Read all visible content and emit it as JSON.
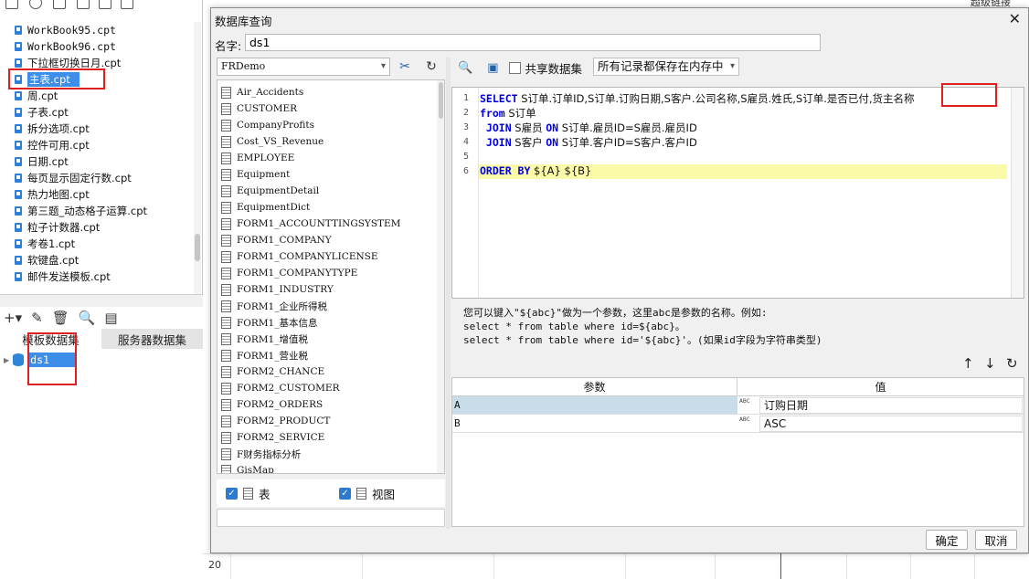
{
  "left_panel": {
    "files": [
      {
        "name": "WorkBook95.cpt",
        "mono": true
      },
      {
        "name": "WorkBook96.cpt",
        "mono": true
      },
      {
        "name": "下拉框切换日月.cpt",
        "mono": false
      },
      {
        "name": "主表.cpt",
        "mono": false,
        "selected": true
      },
      {
        "name": "周.cpt",
        "mono": false
      },
      {
        "name": "子表.cpt",
        "mono": false
      },
      {
        "name": "拆分选项.cpt",
        "mono": false
      },
      {
        "name": "控件可用.cpt",
        "mono": false
      },
      {
        "name": "日期.cpt",
        "mono": false
      },
      {
        "name": "每页显示固定行数.cpt",
        "mono": false
      },
      {
        "name": "热力地图.cpt",
        "mono": false
      },
      {
        "name": "第三题_动态格子运算.cpt",
        "mono": false
      },
      {
        "name": "粒子计数器.cpt",
        "mono": false
      },
      {
        "name": "考卷1.cpt",
        "mono": false
      },
      {
        "name": "软键盘.cpt",
        "mono": false
      },
      {
        "name": "邮件发送模板.cpt",
        "mono": false
      }
    ],
    "dataset_tabs": [
      "模板数据集",
      "服务器数据集"
    ],
    "datasets": [
      "ds1"
    ]
  },
  "sheet": {
    "row_number": "20",
    "top_right_label": "超级链接"
  },
  "dialog": {
    "title": "数据库查询",
    "close_glyph": "✕",
    "name_label": "名字:",
    "name_value": "ds1",
    "connection": "FRDemo",
    "tables": [
      "Air_Accidents",
      "CUSTOMER",
      "CompanyProfits",
      "Cost_VS_Revenue",
      "EMPLOYEE",
      "Equipment",
      "EquipmentDetail",
      "EquipmentDict",
      "FORM1_ACCOUNTTINGSYSTEM",
      "FORM1_COMPANY",
      "FORM1_COMPANYLICENSE",
      "FORM1_COMPANYTYPE",
      "FORM1_INDUSTRY",
      "FORM1_企业所得税",
      "FORM1_基本信息",
      "FORM1_增值税",
      "FORM1_营业税",
      "FORM2_CHANCE",
      "FORM2_CUSTOMER",
      "FORM2_ORDERS",
      "FORM2_PRODUCT",
      "FORM2_SERVICE",
      "F财务指标分析",
      "GisMap"
    ],
    "filter_table_label": "表",
    "filter_view_label": "视图",
    "share_label": "共享数据集",
    "cache_option": "所有记录都保存在内存中",
    "sql_lines": [
      {
        "n": "1",
        "kw": "SELECT",
        "rest": " S订单.订单ID,S订单.订购日期,S客户.公司名称,S雇员.姓氏,S订单.是否已付,货主名称"
      },
      {
        "n": "2",
        "kw": "from",
        "rest": " S订单"
      },
      {
        "n": "3",
        "kw": " JOIN",
        "rest": " S雇员 ",
        "kw2": "ON",
        "rest2": " S订单.雇员ID=S雇员.雇员ID"
      },
      {
        "n": "4",
        "kw": " JOIN",
        "rest": " S客户 ",
        "kw2": "ON",
        "rest2": " S订单.客户ID=S客户.客户ID"
      },
      {
        "n": "5",
        "kw": "",
        "rest": ""
      },
      {
        "n": "6",
        "kw": "ORDER BY",
        "rest": " ${A} ${B}"
      }
    ],
    "hint_lines": [
      "您可以键入\"${abc}\"做为一个参数，这里abc是参数的名称。例如:",
      "select * from table where id=${abc}。",
      "select * from table where id='${abc}'。(如果id字段为字符串类型)"
    ],
    "param_headers": [
      "参数",
      "值"
    ],
    "params": [
      {
        "name": "A",
        "value": "订购日期"
      },
      {
        "name": "B",
        "value": "ASC"
      }
    ],
    "ok_label": "确定",
    "cancel_label": "取消"
  }
}
